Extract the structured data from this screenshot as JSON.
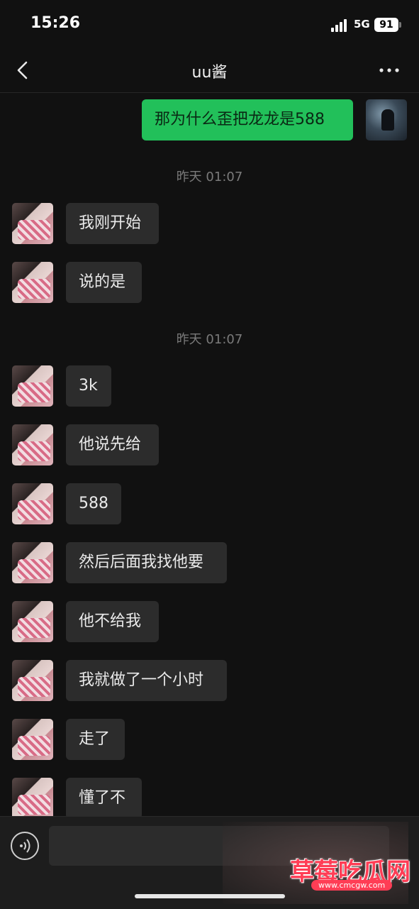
{
  "status_bar": {
    "time": "15:26",
    "network": "5G",
    "battery": "91"
  },
  "nav": {
    "title": "uu酱",
    "back_icon": "chevron-left-icon",
    "more_icon": "more-horizontal-icon"
  },
  "messages": [
    {
      "side": "out",
      "text": "那为什么歪把龙龙是588"
    },
    {
      "type": "time",
      "text": "昨天 01:07"
    },
    {
      "side": "in",
      "text": "我刚开始"
    },
    {
      "side": "in",
      "text": "说的是"
    },
    {
      "type": "time",
      "text": "昨天 01:07"
    },
    {
      "side": "in",
      "text": "3k"
    },
    {
      "side": "in",
      "text": "他说先给"
    },
    {
      "side": "in",
      "text": "588"
    },
    {
      "side": "in",
      "text": "然后后面我找他要"
    },
    {
      "side": "in",
      "text": "他不给我"
    },
    {
      "side": "in",
      "text": "我就做了一个小时"
    },
    {
      "side": "in",
      "text": "走了"
    },
    {
      "side": "in",
      "text": "懂了不"
    }
  ],
  "input_bar": {
    "voice_icon": "voice-icon",
    "placeholder": ""
  },
  "watermark": {
    "title": "草莓吃瓜网",
    "url": "www.cmcgw.com"
  },
  "colors": {
    "background": "#111111",
    "bubble_out": "#22c05a",
    "bubble_in": "#2c2c2c"
  }
}
